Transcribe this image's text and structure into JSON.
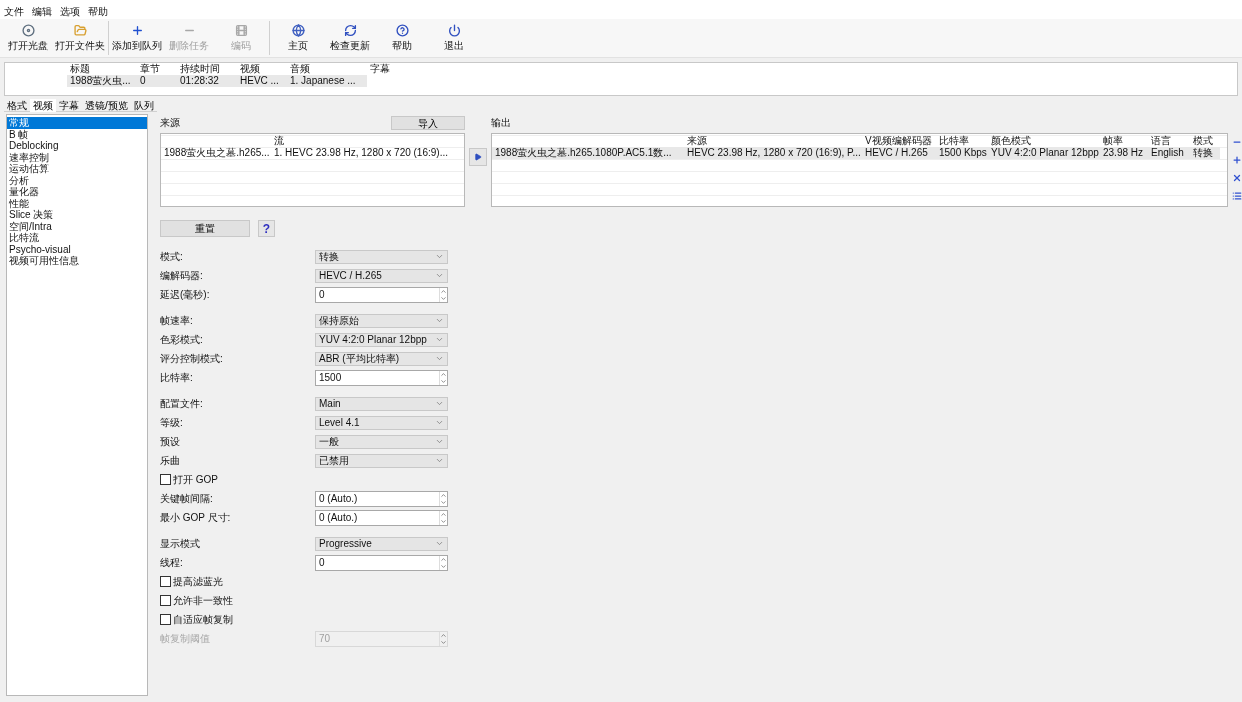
{
  "menu": [
    {
      "label": "文件"
    },
    {
      "label": "编辑"
    },
    {
      "label": "选项"
    },
    {
      "label": "帮助"
    }
  ],
  "toolbar_groups": [
    [
      {
        "label": "打开光盘",
        "disabled": false
      },
      {
        "label": "打开文件夹",
        "disabled": false
      }
    ],
    [
      {
        "label": "添加到队列",
        "disabled": false
      },
      {
        "label": "删除任务",
        "disabled": true
      },
      {
        "label": "编码",
        "disabled": true
      }
    ],
    [
      {
        "label": "主页",
        "disabled": false
      },
      {
        "label": "检查更新",
        "disabled": false
      },
      {
        "label": "帮助",
        "disabled": false
      },
      {
        "label": "退出",
        "disabled": false
      }
    ]
  ],
  "titles_table": {
    "columns": [
      "",
      "标题",
      "章节",
      "持续时间",
      "视频",
      "音频",
      "字幕"
    ],
    "rows": [
      {
        "selected": true,
        "cells": [
          "",
          "1988萤火虫...",
          "0",
          "01:28:32",
          "HEVC ...",
          "1. Japanese ...",
          ""
        ]
      }
    ]
  },
  "tabs": [
    {
      "label": "格式",
      "selected": false
    },
    {
      "label": "视频",
      "selected": true
    },
    {
      "label": "字幕",
      "selected": false
    },
    {
      "label": "透镜/预览",
      "selected": false
    },
    {
      "label": "队列",
      "selected": false
    }
  ],
  "sidebar": {
    "items": [
      {
        "label": "常规",
        "selected": true
      },
      {
        "label": "B 帧",
        "selected": false
      },
      {
        "label": "Deblocking",
        "selected": false
      },
      {
        "label": "速率控制",
        "selected": false
      },
      {
        "label": "运动估算",
        "selected": false
      },
      {
        "label": "分析",
        "selected": false
      },
      {
        "label": "量化器",
        "selected": false
      },
      {
        "label": "性能",
        "selected": false
      },
      {
        "label": "Slice 决策",
        "selected": false
      },
      {
        "label": "空间/Intra",
        "selected": false
      },
      {
        "label": "比特流",
        "selected": false
      },
      {
        "label": "Psycho-visual",
        "selected": false
      },
      {
        "label": "视频可用性信息",
        "selected": false
      }
    ]
  },
  "source": {
    "title": "来源",
    "import_button": "导入",
    "table": {
      "columns": [
        "",
        "流"
      ],
      "rows": [
        {
          "selected": false,
          "cells": [
            "1988萤火虫之墓.h265...",
            "1. HEVC 23.98 Hz, 1280 x 720 (16:9)..."
          ]
        }
      ]
    }
  },
  "output": {
    "title": "输出",
    "table": {
      "columns": [
        "",
        "来源",
        "V视频编解码器",
        "比特率",
        "颜色模式",
        "帧率",
        "语言",
        "模式"
      ],
      "rows": [
        {
          "selected": true,
          "cells": [
            "1988萤火虫之墓.h265.1080P.AC5.1数...",
            "HEVC 23.98 Hz, 1280 x 720 (16:9), P...",
            "HEVC / H.265",
            "1500 Kbps",
            "YUV 4:2:0 Planar 12bpp",
            "23.98 Hz",
            "English",
            "转换"
          ]
        }
      ]
    }
  },
  "reset_button": "重置",
  "help_button": "?",
  "form_groups": [
    [
      {
        "kind": "select",
        "label": "模式:",
        "value": "转换",
        "disabled": false
      },
      {
        "kind": "select",
        "label": "编解码器:",
        "value": "HEVC / H.265",
        "disabled": false
      },
      {
        "kind": "spin",
        "label": "延迟(毫秒):",
        "value": "0",
        "disabled": false
      }
    ],
    [
      {
        "kind": "select",
        "label": "帧速率:",
        "value": "保持原始",
        "disabled": false
      },
      {
        "kind": "select",
        "label": "色彩模式:",
        "value": "YUV 4:2:0 Planar 12bpp",
        "disabled": false
      },
      {
        "kind": "select",
        "label": "评分控制模式:",
        "value": "ABR (平均比特率)",
        "disabled": false
      },
      {
        "kind": "spin",
        "label": "比特率:",
        "value": "1500",
        "disabled": false
      }
    ],
    [
      {
        "kind": "select",
        "label": "配置文件:",
        "value": "Main",
        "disabled": false
      },
      {
        "kind": "select",
        "label": "等级:",
        "value": "Level 4.1",
        "disabled": false
      },
      {
        "kind": "select",
        "label": "预设",
        "value": "一般",
        "disabled": false
      },
      {
        "kind": "select",
        "label": "乐曲",
        "value": "已禁用",
        "disabled": false
      },
      {
        "kind": "checkbox",
        "label": "打开 GOP",
        "checked": false
      },
      {
        "kind": "spin",
        "label": "关键帧间隔:",
        "value": "0 (Auto.)",
        "disabled": false
      },
      {
        "kind": "spin",
        "label": "最小 GOP 尺寸:",
        "value": "0 (Auto.)",
        "disabled": false
      }
    ],
    [
      {
        "kind": "select",
        "label": "显示模式",
        "value": "Progressive",
        "disabled": false
      },
      {
        "kind": "spin",
        "label": "线程:",
        "value": "0",
        "disabled": false
      },
      {
        "kind": "checkbox",
        "label": "提高滤蓝光",
        "checked": false
      },
      {
        "kind": "checkbox",
        "label": "允许非一致性",
        "checked": false
      },
      {
        "kind": "checkbox",
        "label": "自适应帧复制",
        "checked": false
      },
      {
        "kind": "spin",
        "label": "帧复制阈值",
        "value": "70",
        "disabled": true
      }
    ]
  ]
}
